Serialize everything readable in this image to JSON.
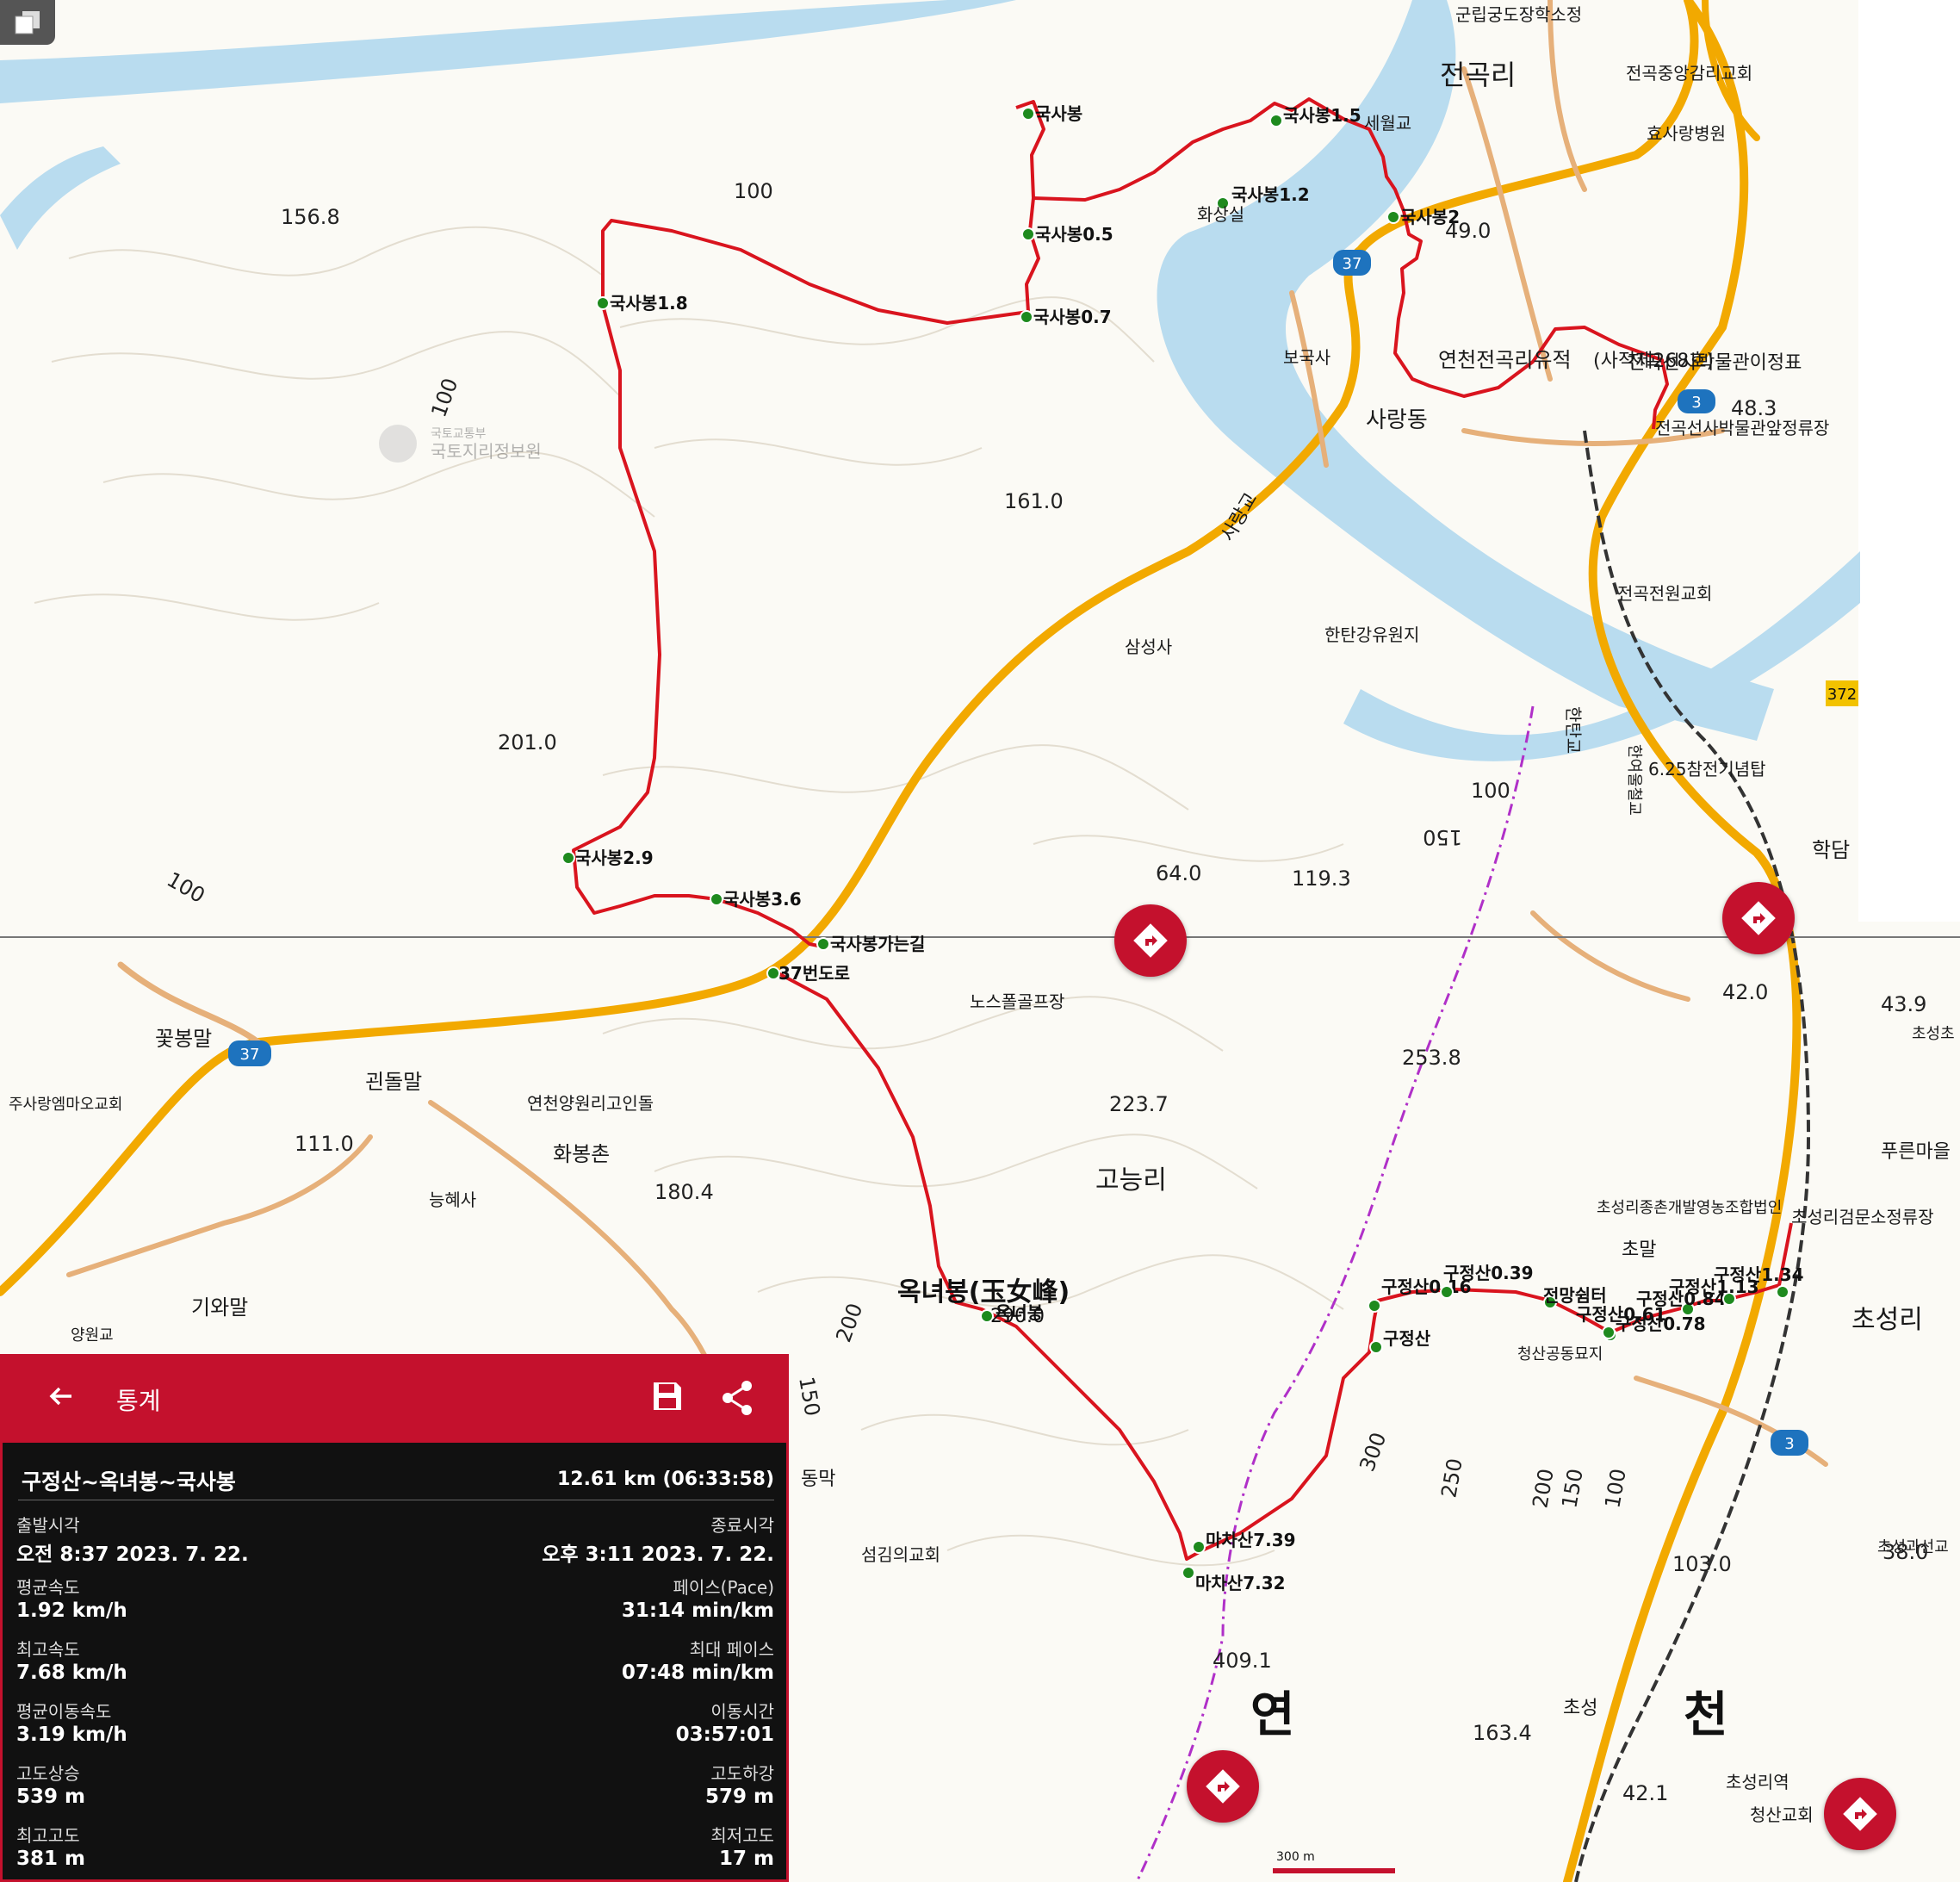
{
  "map": {
    "town_labels": [
      "전곡리",
      "사랑동",
      "고능리",
      "초성리",
      "꽃봉말",
      "괸돌말",
      "화봉촌",
      "기와말",
      "초말",
      "동막",
      "학담",
      "푸른마을",
      "초성"
    ],
    "place_labels": [
      "군립궁도장학소정",
      "전곡중앙감리교회",
      "효사랑병원",
      "보국사",
      "연천전곡리유적",
      "(사적제268호)",
      "전곡선사박물관이정표",
      "전곡선사박물관앞정류장",
      "전곡전원교회",
      "한탄강유원지",
      "삼성사",
      "6.25참전기념탑",
      "노스폴골프장",
      "주사랑엠마오교회",
      "연천양원리고인돌",
      "능혜사",
      "양원교",
      "섬김의교회",
      "초성리종촌개발영농조합법인",
      "초성리검문소정류장",
      "청산공동묘지",
      "초성과선교",
      "초성리역",
      "청산교회",
      "초성초",
      "세월교",
      "화상실",
      "사랑교",
      "한탄교",
      "한여울철교",
      "국토교통부",
      "국토지리정보원"
    ],
    "big_labels": [
      "연",
      "천"
    ],
    "route_shields": [
      "37",
      "37",
      "3",
      "3",
      "372"
    ],
    "elevations": [
      "156.8",
      "161.0",
      "201.0",
      "64.0",
      "119.3",
      "49.0",
      "48.3",
      "42.0",
      "43.9",
      "111.0",
      "180.4",
      "223.7",
      "253.8",
      "409.1",
      "163.4",
      "103.0",
      "38.0",
      "42.1"
    ],
    "contours": [
      "100",
      "100",
      "100",
      "100",
      "150",
      "200",
      "150",
      "300",
      "250",
      "200",
      "150",
      "100"
    ],
    "peak_label": "옥녀봉(玉女峰)",
    "peak_elev": "290.0",
    "scale_label": "300 m",
    "waypoints": [
      "국사봉",
      "국사봉0.5",
      "국사봉0.7",
      "국사봉1.2",
      "국사봉1.5",
      "국사봉1.8",
      "국사봉2",
      "국사봉2.9",
      "국사봉3.6",
      "국사봉가는길",
      "37번도로",
      "옥녀봉",
      "마차산7.32",
      "마차산7.39",
      "구정산",
      "구정산0.16",
      "구정산0.39",
      "전망쉼터",
      "구정산0.61",
      "구정산0.78",
      "구정산0.84",
      "구정산1.13",
      "구정산1.34"
    ],
    "colors": {
      "route": "#d9141e",
      "road": "#f2a900",
      "water": "#b9dcef",
      "boundary": "#b030c8",
      "brand": "#c4112d"
    }
  },
  "stats": {
    "header_title": "통계",
    "track_name": "구정산~옥녀봉~국사봉",
    "distance_time": "12.61 km (06:33:58)",
    "rows": [
      {
        "lk": "출발시각",
        "lv": "오전 8:37 2023. 7. 22.",
        "rk": "종료시각",
        "rv": "오후 3:11 2023. 7. 22."
      },
      {
        "lk": "평균속도",
        "lv": "1.92 km/h",
        "rk": "페이스(Pace)",
        "rv": "31:14 min/km"
      },
      {
        "lk": "최고속도",
        "lv": "7.68 km/h",
        "rk": "최대 페이스",
        "rv": "07:48 min/km"
      },
      {
        "lk": "평균이동속도",
        "lv": "3.19 km/h",
        "rk": "이동시간",
        "rv": "03:57:01"
      },
      {
        "lk": "고도상승",
        "lv": "539 m",
        "rk": "고도하강",
        "rv": "579 m"
      },
      {
        "lk": "최고고도",
        "lv": "381 m",
        "rk": "최저고도",
        "rv": "17 m"
      }
    ]
  }
}
